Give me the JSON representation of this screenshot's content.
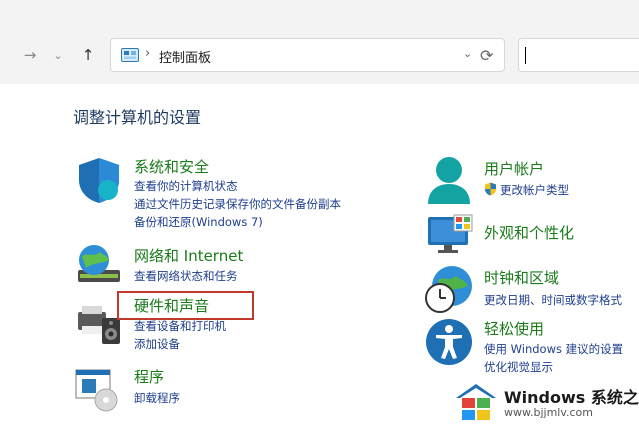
{
  "address_bar": {
    "separator": "›",
    "path": "控制面板",
    "dropdown": "⌄"
  },
  "heading": "调整计算机的设置",
  "left_categories": [
    {
      "title": "系统和安全",
      "links": [
        "查看你的计算机状态",
        "通过文件历史记录保存你的文件备份副本",
        "备份和还原(Windows 7)"
      ]
    },
    {
      "title": "网络和 Internet",
      "links": [
        "查看网络状态和任务"
      ]
    },
    {
      "title": "硬件和声音",
      "links": [
        "查看设备和打印机",
        "添加设备"
      ]
    },
    {
      "title": "程序",
      "links": [
        "卸载程序"
      ]
    }
  ],
  "right_categories": [
    {
      "title": "用户帐户",
      "links": [
        "更改帐户类型"
      ]
    },
    {
      "title": "外观和个性化",
      "links": []
    },
    {
      "title": "时钟和区域",
      "links": [
        "更改日期、时间或数字格式"
      ]
    },
    {
      "title": "轻松使用",
      "links": [
        "使用 Windows 建议的设置",
        "优化视觉显示"
      ]
    }
  ],
  "watermark": {
    "title": "Windows 系统之家",
    "url": "www.bjjmlv.com"
  }
}
